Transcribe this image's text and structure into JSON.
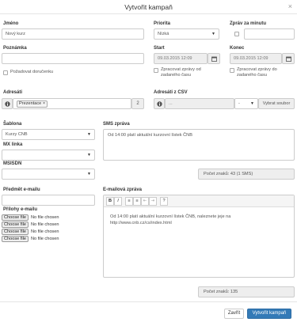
{
  "dialog": {
    "title": "Vytvořit kampaň",
    "close_icon": "×"
  },
  "fields": {
    "name": {
      "label": "Jméno",
      "value": "Nový kurz"
    },
    "priority": {
      "label": "Priorita",
      "value": "Nízká"
    },
    "rate": {
      "label": "Zpráv za minutu",
      "value": ""
    },
    "note": {
      "label": "Poznámka",
      "value": ""
    },
    "start": {
      "label": "Start",
      "value": "09.03.2015 12:09"
    },
    "end": {
      "label": "Konec",
      "value": "09.03.2015 12:09"
    },
    "delivery_report": {
      "label": "Požadovat doručenku",
      "checked": false
    },
    "process_from": {
      "label_line1": "Zpracovat zprávy od",
      "label_line2": "zadaného času",
      "checked": false
    },
    "process_to": {
      "label_line1": "Zpracovat zprávy do",
      "label_line2": "zadaného času",
      "checked": false
    },
    "recipients": {
      "label": "Adresáti",
      "tag": "Prezentace",
      "tag_remove": "×",
      "count": "2"
    },
    "recipients_csv": {
      "label": "Adresáti z CSV",
      "placeholder": "...",
      "select_value": "-",
      "browse_label": "Vybrat soubor"
    },
    "template": {
      "label": "Šablona",
      "value": "Kurzy CNB"
    },
    "mx_line": {
      "label": "MX linka",
      "value": ""
    },
    "msisdn": {
      "label": "MSISDN",
      "value": ""
    },
    "sms": {
      "label": "SMS zpráva",
      "text": "Od 14:00 platí aktuální kurzovní lístek ČNB",
      "count": "Počet znaků: 43 (1 SMS)"
    },
    "email_subject": {
      "label": "Předmět e-mailu",
      "value": ""
    },
    "attachments": {
      "label": "Přílohy e-mailu",
      "button_label": "Choose file",
      "status": "No file chosen",
      "rows": 4
    },
    "email": {
      "label": "E-mailová zpráva",
      "text": "Od 14:00 platí aktuální kurzovní lístek ČNB, naleznete jeje na http://www.cnb.cz/cs/index.html",
      "count": "Počet znaků: 135",
      "toolbar": {
        "bold": "B",
        "italic": "I",
        "list": "≡",
        "list2": "≡",
        "indent": "⇤",
        "outdent": "⇥",
        "help": "?"
      }
    }
  },
  "buttons": {
    "close": "Zavřít",
    "create": "Vytvořit kampaň"
  },
  "icons": {
    "info": "info-icon",
    "calendar": "calendar-icon",
    "caret": "caret-down-icon"
  },
  "colors": {
    "primary": "#337ab7",
    "border": "#cccccc",
    "addon": "#eeeeee"
  }
}
